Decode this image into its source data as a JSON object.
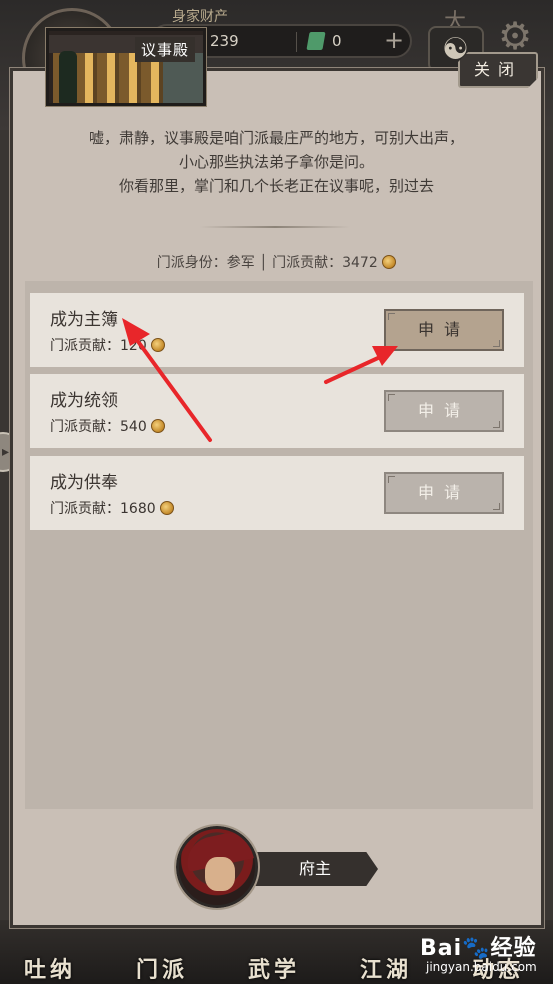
{
  "hud": {
    "wealth_label": "身家财产",
    "silver_amount": "239",
    "jade_amount": "0",
    "plus_glyph": "+",
    "taiji_glyph": "☯",
    "gear_glyph": "⚙",
    "top_glyph": "大"
  },
  "panel": {
    "location_title": "议事殿",
    "close_label": "关闭",
    "dialogue": [
      "嘘，肃静，议事殿是咱门派最庄严的地方，可别大出声，",
      "小心那些执法弟子拿你是问。",
      "你看那里，掌门和几个长老正在议事呢，别过去"
    ],
    "rank_text": "门派身份：参军 │ 门派贡献：3472",
    "positions": [
      {
        "title": "成为主簿",
        "cost_text": "门派贡献：120",
        "button": "申请",
        "active": true
      },
      {
        "title": "成为统领",
        "cost_text": "门派贡献：540",
        "button": "申请",
        "active": false
      },
      {
        "title": "成为供奉",
        "cost_text": "门派贡献：1680",
        "button": "申请",
        "active": false
      }
    ],
    "character_name": "府主"
  },
  "nav": {
    "tabs": [
      "吐纳",
      "门派",
      "武学",
      "江湖",
      "动态"
    ]
  },
  "watermark": {
    "logo": "Bai🐾经验",
    "url": "jingyan.baidu.com"
  },
  "colors": {
    "arrow": "#e8262a",
    "panel_bg": "#c9bfb6",
    "row_bg": "#e8e3dc",
    "active_button": "#b4a38f"
  }
}
